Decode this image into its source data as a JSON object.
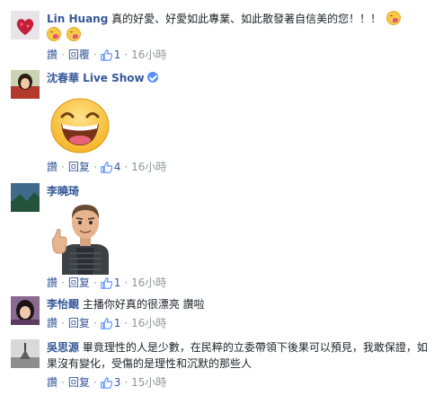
{
  "comments": [
    {
      "name": "Lin Huang",
      "text": "真的好愛、好愛如此專業、如此散發著自信美的您！！！",
      "reactions": {
        "like": "讚",
        "reply": "回覆",
        "count": "1",
        "time": "16小時"
      }
    },
    {
      "name": "沈春華 Live Show",
      "verified": true,
      "sticker": "grinning-face-sticker",
      "reactions": {
        "like": "讚",
        "reply": "回复",
        "count": "4",
        "time": "16小時"
      }
    },
    {
      "name": "李曉琦",
      "sticker": "thumbs-up-man-sticker",
      "reactions": {
        "like": "讚",
        "reply": "回复",
        "count": "1",
        "time": "16小時"
      }
    },
    {
      "name": "李怡靦",
      "text": "主播你好真的很漂亮 讚啦",
      "reactions": {
        "like": "讚",
        "reply": "回复",
        "count": "1",
        "time": "16小時"
      }
    },
    {
      "name": "吳思源",
      "text": "畢竟理性的人是少數，在民粹的立委帶領下後果可以預見，我敢保證，如果沒有變化，受傷的是理性和沉默的那些人",
      "reactions": {
        "like": "讚",
        "reply": "回复",
        "count": "3",
        "time": "15小時"
      }
    }
  ],
  "colors": {
    "name": "#365899",
    "meta": "#90949c",
    "text": "#1d2129",
    "like_blue": "#5890ff"
  }
}
